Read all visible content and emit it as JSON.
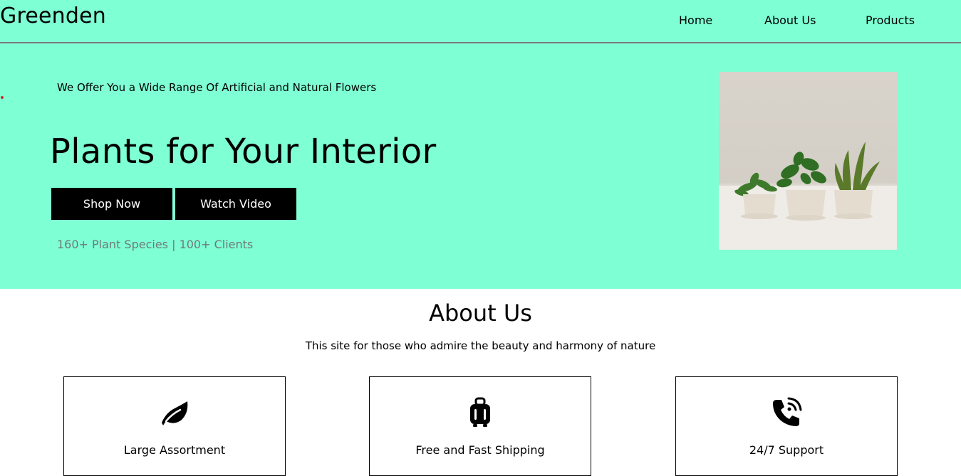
{
  "header": {
    "logo": "Greenden",
    "nav": [
      {
        "label": "Home"
      },
      {
        "label": "About Us"
      },
      {
        "label": "Products"
      }
    ]
  },
  "hero": {
    "tagline": "We Offer You a Wide Range Of Artificial and Natural Flowers",
    "title": "Plants for Your Interior",
    "buttons": {
      "shop": "Shop Now",
      "video": "Watch Video"
    },
    "stats": "160+ Plant Species | 100+ Clients",
    "image_icon": "potted-plants-image"
  },
  "about": {
    "title": "About Us",
    "subtitle": "This site for those who admire the beauty and harmony of nature",
    "features": [
      {
        "icon": "leaf-icon",
        "title": "Large Assortment"
      },
      {
        "icon": "luggage-icon",
        "title": "Free and Fast Shipping"
      },
      {
        "icon": "phone-call-icon",
        "title": "24/7 Support"
      }
    ]
  },
  "colors": {
    "hero_background": "#7fffd4",
    "button_background": "#000000",
    "button_text": "#ffffff",
    "stats_text": "#6e7a78"
  }
}
